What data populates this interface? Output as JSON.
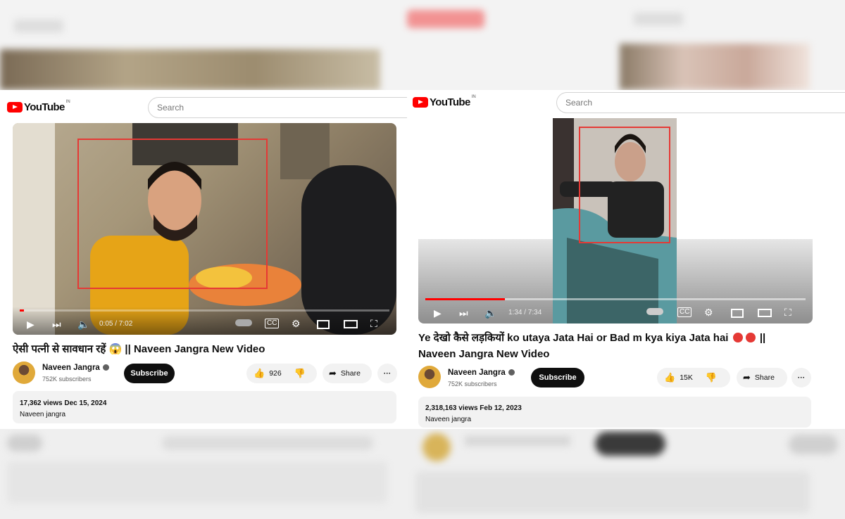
{
  "left": {
    "search_placeholder": "Search",
    "logo_word": "YouTube",
    "logo_region": "IN",
    "time_display": "0:05 / 7:02",
    "progress": 0.012,
    "title": "ऐसी पत्नी से सावधान रहें 😱 || Naveen Jangra New Video",
    "channel_name": "Naveen Jangra",
    "subscribers": "752K subscribers",
    "subscribe_label": "Subscribe",
    "like_count": "926",
    "share_label": "Share",
    "views_date": "17,362 views  Dec 15, 2024",
    "description": "Naveen jangra"
  },
  "right": {
    "search_placeholder": "Search",
    "logo_word": "YouTube",
    "logo_region": "IN",
    "time_display": "1:34 / 7:34",
    "progress": 0.21,
    "title_line1": "Ye देखो कैसे लड़कियों ko utaya Jata Hai or Bad m kya kiya Jata hai",
    "title_line1_suffix": "||",
    "title_line2": "Naveen Jangra New Video",
    "channel_name": "Naveen Jangra",
    "subscribers": "752K subscribers",
    "subscribe_label": "Subscribe",
    "like_count": "15K",
    "share_label": "Share",
    "views_date": "2,318,163 views  Feb 12, 2023",
    "description": "Naveen jangra"
  },
  "colors": {
    "accent": "#ff0000",
    "frame": "#e53935",
    "subscribe_bg": "#0f0f0f"
  },
  "icons": [
    "play-icon",
    "next-icon",
    "volume-icon",
    "autoplay-toggle",
    "cc-icon",
    "settings-icon",
    "miniplayer-icon",
    "theater-icon",
    "fullscreen-icon",
    "like-icon",
    "dislike-icon",
    "share-icon",
    "more-icon"
  ]
}
